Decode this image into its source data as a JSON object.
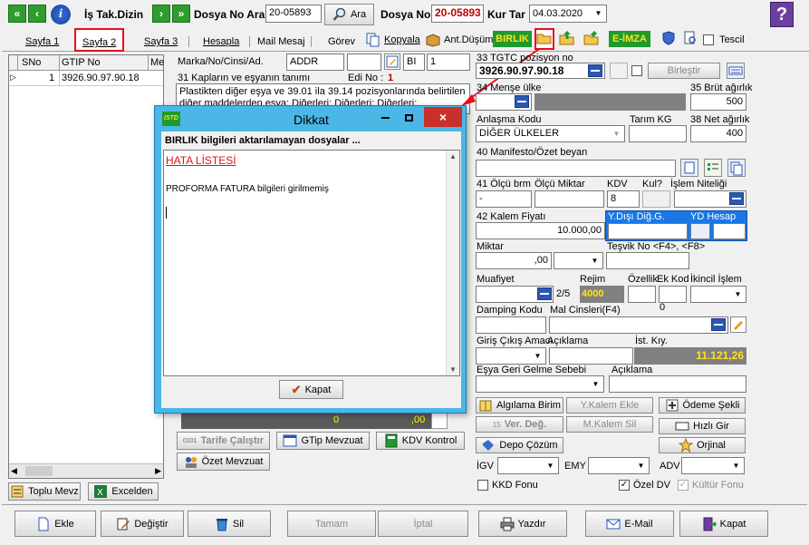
{
  "toolbar": {
    "is_tak_label": "İş Tak.Dizin",
    "dosya_no_ara_label": "Dosya No Ara",
    "dosya_no_ara_value": "20-05893",
    "ara_label": "Ara",
    "dosya_no_label": "Dosya No",
    "dosya_no_value": "20-05893",
    "kur_tar_label": "Kur Tar",
    "kur_tar_value": "04.03.2020",
    "help": "?"
  },
  "tabs": [
    {
      "label": "Sayfa 1"
    },
    {
      "label": "Sayfa 2"
    },
    {
      "label": "Sayfa 3"
    },
    {
      "label": "Hesapla"
    },
    {
      "label": "Mail Mesaj"
    },
    {
      "label": "Görev"
    },
    {
      "label": "Kopyala"
    },
    {
      "label": "Ant.Düşüm"
    },
    {
      "label": "BIRLIK"
    },
    {
      "label": "E-İMZA"
    },
    {
      "label": "Tescil"
    }
  ],
  "grid": {
    "columns": [
      "SNo",
      "GTIP No",
      "Me"
    ],
    "rows": [
      {
        "marker": "▷",
        "sno": "1",
        "gtip": "3926.90.97.90.18"
      }
    ]
  },
  "left_buttons": {
    "toplu": "Toplu Mevz",
    "excel": "Excelden"
  },
  "middle": {
    "marka_label": "Marka/No/Cinsi/Ad.",
    "marka_value": "ADDR",
    "bi_value": "BI",
    "one_value": "1",
    "kaplar_label": "31 Kapların ve eşyanın tanımı",
    "edi_no_label": "Edi No :",
    "edi_no_value": "1",
    "desc_text": "Plastikten diğer eşya ve 39.01 ila 39.14 pozisyonlarında belirtilen diğer maddelerden eşya: Diğerleri: Diğerleri: Diğerleri:",
    "hidden_value1": "0",
    "hidden_value2": ",00",
    "tarife": "Tarife Çalıştır",
    "tarife_small": "0101",
    "gtip_mevzuat": "GTip Mevzuat",
    "kdv_kontrol": "KDV Kontrol",
    "ozet_mevzuat": "Özet Mevzuat"
  },
  "right": {
    "tgtc_label": "33 TGTC pozisyon no",
    "tgtc_value": "3926.90.97.90.18",
    "birlestir": "Birleştir",
    "mense_label": "34 Menşe ülke",
    "brut_label": "35 Brüt ağırlık",
    "brut_value": "500",
    "anlasma_label": "Anlaşma Kodu",
    "anlasma_value": "DİĞER ÜLKELER",
    "tarim_label": "Tarım KG",
    "net_label": "38 Net ağırlık",
    "net_value": "400",
    "manifesto_label": "40 Manifesto/Özet beyan",
    "olcu_brm_label": "41 Ölçü brm",
    "olcu_brm_value": "-",
    "olcu_miktar_label": "Ölçü Miktar",
    "kdv_label": "KDV",
    "kdv_value": "8",
    "kul_label": "Kul?",
    "islem_label": "İşlem Niteliği",
    "kalem_fiyati_label": "42 Kalem Fiyatı",
    "kalem_fiyati_value": "10.000,00",
    "ydisi_label": "Y.Dışı Diğ.G.",
    "yd_hesap_label": "YD Hesap",
    "miktar_label": "Miktar",
    "miktar_value": ",00",
    "tesvik_label": "Teşvik No <F4>, <F8>",
    "muafiyet_label": "Muafiyet",
    "rejim_label": "Rejim",
    "rejim_prefix": "2/5",
    "rejim_value": "4000",
    "ozellik_label": "Özellik",
    "ek_kod_label": "Ek Kod",
    "ikincil_label": "İkincil İşlem",
    "damping_label": "Damping Kodu",
    "mal_cinsleri_label": "Mal Cinsleri(F4)",
    "mal_cinsleri_zero": "0",
    "giris_label": "Giriş Çıkış Amacı",
    "aciklama_label": "Açıklama",
    "ist_kiy_label": "İst. Kıy.",
    "ist_kiy_value": "11.121,26",
    "esya_geri_label": "Eşya Geri Gelme Sebebi",
    "aciklama2_label": "Açıklama",
    "algilama": "Algılama Birim",
    "y_kalem": "Y.Kalem Ekle",
    "odeme": "Ödeme Şekli",
    "ver_deg": "Ver. Değ.",
    "ver_deg_num": "15",
    "m_kalem": "M.Kalem Sil",
    "hizli": "Hızlı Gir",
    "depo": "Depo Çözüm",
    "orjinal": "Orjinal",
    "igv_label": "İGV",
    "emy_label": "EMY",
    "adv_label": "ADV",
    "kkd_label": "KKD Fonu",
    "ozel_dv_label": "Özel DV",
    "kultur_label": "Kültür Fonu"
  },
  "bottom": {
    "ekle": "Ekle",
    "degistir": "Değiştir",
    "sil": "Sil",
    "tamam": "Tamam",
    "iptal": "İptal",
    "yazdir": "Yazdır",
    "email": "E-Mail",
    "kapat": "Kapat"
  },
  "dialog": {
    "title": "Dikkat",
    "logo": "ISTD",
    "heading": "BIRLIK bilgileri aktarılamayan dosyalar ...",
    "hata_title": "HATA LİSTESİ",
    "error_line": "PROFORMA FATURA bilgileri girilmemiş",
    "kapat": "Kapat"
  }
}
